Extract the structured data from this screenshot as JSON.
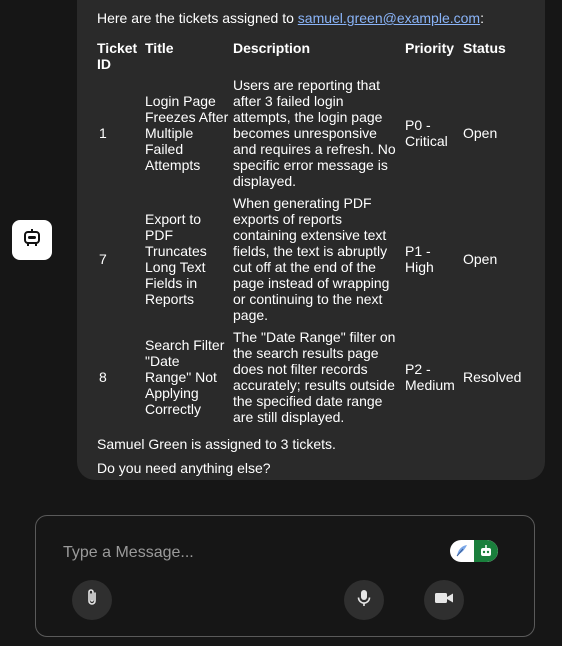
{
  "chat": {
    "intro_prefix": "Here are the tickets assigned to ",
    "email": "samuel.green@example.com",
    "intro_suffix": ":",
    "table": {
      "headers": [
        "Ticket ID",
        "Title",
        "Description",
        "Priority",
        "Status"
      ],
      "rows": [
        {
          "id": "1",
          "title": "Login Page Freezes After Multiple Failed Attempts",
          "description": "Users are reporting that after 3 failed login attempts, the login page becomes unresponsive and requires a refresh. No specific error message is displayed.",
          "priority": "P0 - Critical",
          "status": "Open"
        },
        {
          "id": "7",
          "title": "Export to PDF Truncates Long Text Fields in Reports",
          "description": "When generating PDF exports of reports containing extensive text fields, the text is abruptly cut off at the end of the page instead of wrapping or continuing to the next page.",
          "priority": "P1 - High",
          "status": "Open"
        },
        {
          "id": "8",
          "title": "Search Filter \"Date Range\" Not Applying Correctly",
          "description": "The \"Date Range\" filter on the search results page does not filter records accurately; results outside the specified date range are still displayed.",
          "priority": "P2 - Medium",
          "status": "Resolved"
        }
      ]
    },
    "summary": "Samuel Green is assigned to 3 tickets.",
    "followup": "Do you need anything else?"
  },
  "composer": {
    "placeholder": "Type a Message..."
  },
  "icons": {
    "bot": "robot-icon",
    "attach": "paperclip-icon",
    "mic": "microphone-icon",
    "video": "video-camera-icon",
    "toggle_left": "feather-icon",
    "toggle_right": "robot-icon"
  },
  "colors": {
    "background": "#161616",
    "bubble": "#2a2a2a",
    "link": "#8ab4f8",
    "toggle_active": "#1a7f3c"
  }
}
